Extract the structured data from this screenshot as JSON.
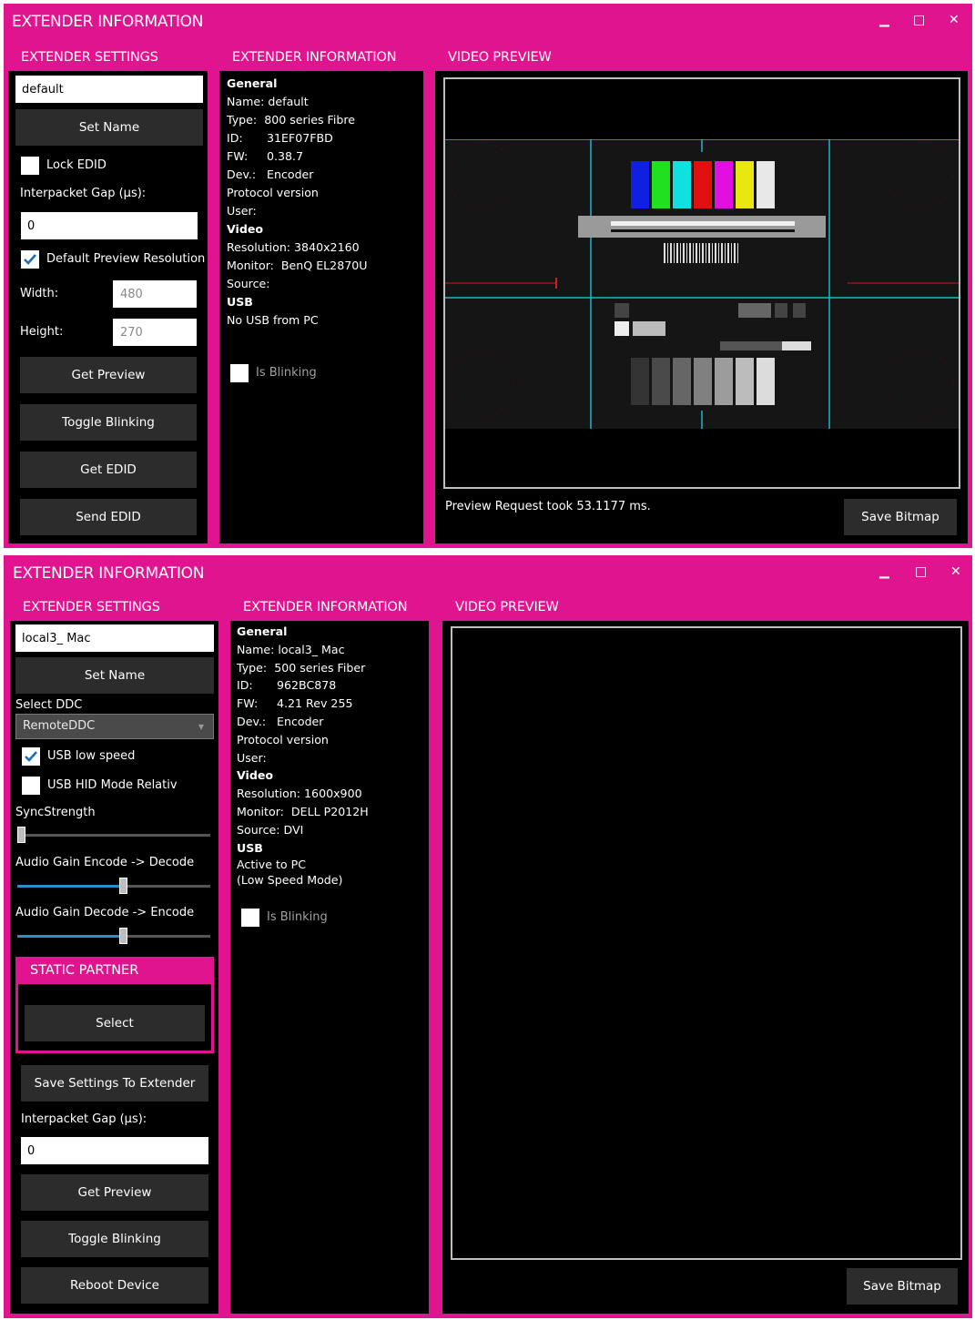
{
  "window1": {
    "title": "EXTENDER INFORMATION",
    "settings": {
      "header": "EXTENDER SETTINGS",
      "name_value": "default",
      "set_name": "Set Name",
      "lock_edid": "Lock EDID",
      "lock_edid_checked": false,
      "interpacket_gap_label": "Interpacket Gap (µs):",
      "interpacket_gap_value": "0",
      "default_preview_resolution": "Default Preview Resolution",
      "default_preview_checked": true,
      "width_label": "Width:",
      "width_value": "480",
      "height_label": "Height:",
      "height_value": "270",
      "get_preview": "Get Preview",
      "toggle_blinking": "Toggle Blinking",
      "get_edid": "Get EDID",
      "send_edid": "Send EDID"
    },
    "info": {
      "header": "EXTENDER INFORMATION",
      "general": "General",
      "name": "Name: default",
      "type_label": "Type:",
      "type_value": "800 series Fibre",
      "id_label": "ID:",
      "id_value": "31EF07FBD",
      "fw_label": "FW:",
      "fw_value": "0.38.7",
      "dev_label": "Dev.:",
      "dev_value": "Encoder",
      "protocol": "Protocol version",
      "user": "User:",
      "video": "Video",
      "resolution": "Resolution: 3840x2160",
      "monitor_label": "Monitor:",
      "monitor_value": "BenQ EL2870U",
      "source": "Source:",
      "usb": "USB",
      "usb_status": "No USB from PC",
      "is_blinking": "Is Blinking"
    },
    "preview": {
      "header": "VIDEO PREVIEW",
      "status": "Preview Request took 53.1177 ms.",
      "save_bitmap": "Save Bitmap"
    }
  },
  "window2": {
    "title": "EXTENDER INFORMATION",
    "settings": {
      "header": "EXTENDER SETTINGS",
      "name_value": "local3_ Mac",
      "set_name": "Set Name",
      "select_ddc_label": "Select DDC",
      "select_ddc_value": "RemoteDDC",
      "usb_low_speed": "USB low speed",
      "usb_low_speed_checked": true,
      "usb_hid_mode": "USB HID Mode Relativ",
      "usb_hid_checked": false,
      "sync_strength": "SyncStrength",
      "sync_strength_level": 0.0,
      "audio_gain_enc_dec": "Audio Gain Encode -> Decode",
      "audio_gain_enc_dec_level": 0.55,
      "audio_gain_dec_enc": "Audio Gain Decode -> Encode",
      "audio_gain_dec_enc_level": 0.55,
      "static_partner_header": "STATIC PARTNER",
      "select": "Select",
      "save_settings": "Save Settings To Extender",
      "interpacket_gap_label": "Interpacket Gap (µs):",
      "interpacket_gap_value": "0",
      "get_preview": "Get Preview",
      "toggle_blinking": "Toggle Blinking",
      "reboot_device": "Reboot Device"
    },
    "info": {
      "header": "EXTENDER INFORMATION",
      "general": "General",
      "name": "Name: local3_ Mac",
      "type_label": "Type:",
      "type_value": "500 series Fiber",
      "id_label": "ID:",
      "id_value": "962BC878",
      "fw_label": "FW:",
      "fw_value": "4.21 Rev 255",
      "dev_label": "Dev.:",
      "dev_value": "Encoder",
      "protocol": "Protocol version",
      "user": "User:",
      "video": "Video",
      "resolution": "Resolution: 1600x900",
      "monitor_label": "Monitor:",
      "monitor_value": "DELL P2012H",
      "source": "Source: DVI",
      "usb": "USB",
      "usb_status_1": "Active to PC",
      "usb_status_2": "(Low Speed Mode)",
      "is_blinking": "Is Blinking"
    },
    "preview": {
      "header": "VIDEO PREVIEW",
      "save_bitmap": "Save Bitmap"
    }
  },
  "icons": {
    "minimize": "minimize-icon",
    "maximize": "maximize-icon",
    "close": "close-icon",
    "checkmark": "checkmark-icon",
    "dropdown": "chevron-down-icon"
  },
  "colors": {
    "accent": "#e0148f",
    "button": "#2c2c2c",
    "checkmark": "#1a6fb5",
    "slider_fill": "#2a8fc8",
    "preview_line": "#1ab8c8"
  }
}
